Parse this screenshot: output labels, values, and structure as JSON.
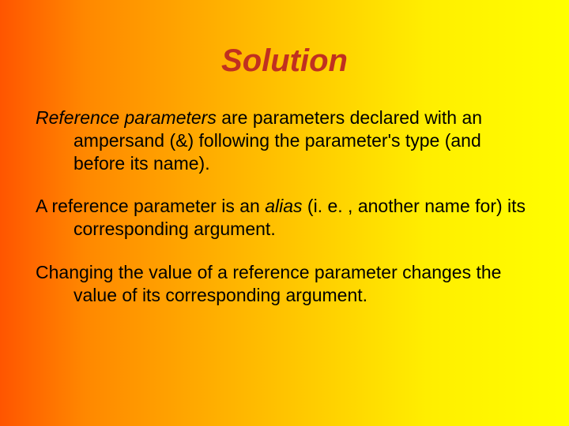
{
  "title": "Solution",
  "para1": {
    "lead": "Reference parameters",
    "rest": " are parameters declared with an ampersand (&) following the parameter's type (and before its name)."
  },
  "para2": {
    "pre": "A reference parameter is an ",
    "italic": "alias",
    "post": " (i. e. , another name for) its corresponding argument."
  },
  "para3": "Changing the value of a reference parameter changes the value of its corresponding argument."
}
